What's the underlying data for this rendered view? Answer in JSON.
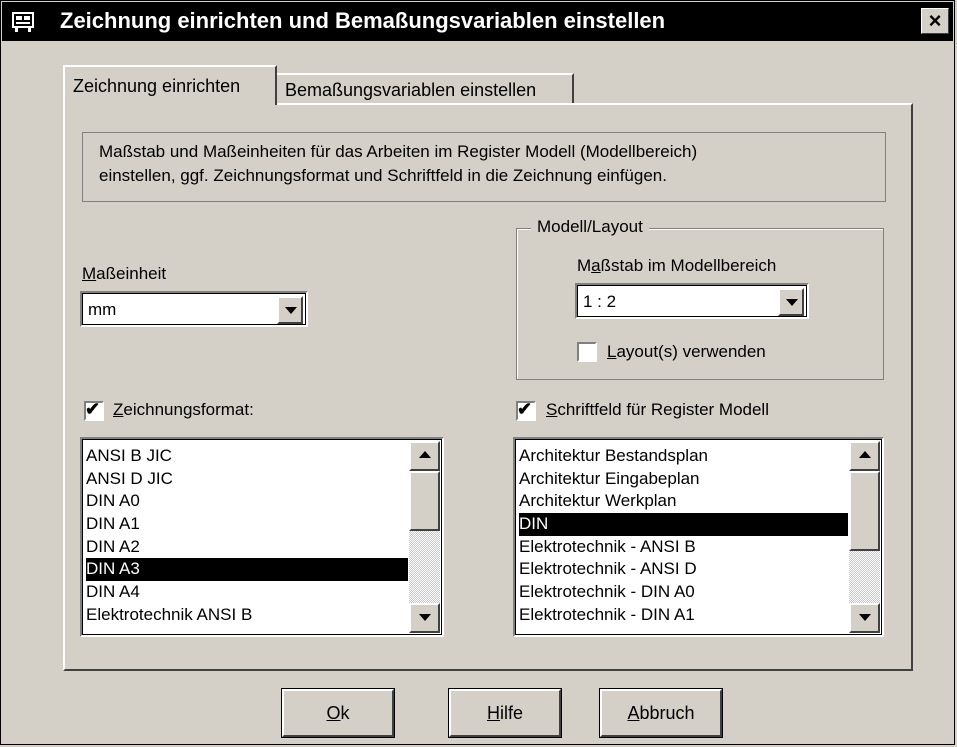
{
  "window": {
    "title": "Zeichnung einrichten und Bemaßungsvariablen einstellen",
    "close_label": "×"
  },
  "tabs": [
    {
      "label": "Zeichnung einrichten",
      "active": true
    },
    {
      "label": "Bemaßungsvariablen einstellen",
      "active": false
    }
  ],
  "description": {
    "line1": "Maßstab und Maßeinheiten für das Arbeiten im Register Modell (Modellbereich)",
    "line2": "einstellen, ggf. Zeichnungsformat und Schriftfeld in die Zeichnung einfügen."
  },
  "unit": {
    "label_accel": "M",
    "label_rest": "aßeinheit",
    "value": "mm"
  },
  "model_layout": {
    "legend": "Modell/Layout",
    "scale_label_pre": "M",
    "scale_label_accel": "a",
    "scale_label_rest": "ßstab im Modellbereich",
    "scale_value": "1 : 2",
    "layout_checkbox_accel": "L",
    "layout_checkbox_rest": "ayout(s) verwenden",
    "layout_checked": false
  },
  "format": {
    "checkbox_accel": "Z",
    "checkbox_rest": "eichnungsformat:",
    "checked": true,
    "check_glyph": "✔",
    "items": [
      "ANSI B JIC",
      "ANSI D JIC",
      "DIN A0",
      "DIN A1",
      "DIN A2",
      "DIN A3",
      "DIN A4",
      "Elektrotechnik ANSI B"
    ],
    "selected": "DIN A3"
  },
  "title_block": {
    "checkbox_accel": "S",
    "checkbox_rest": "chriftfeld für Register Modell",
    "checked": true,
    "check_glyph": "✔",
    "items": [
      "Architektur Bestandsplan",
      "Architektur Eingabeplan",
      "Architektur Werkplan",
      "DIN",
      "Elektrotechnik - ANSI B",
      "Elektrotechnik - ANSI D",
      "Elektrotechnik - DIN A0",
      "Elektrotechnik - DIN A1"
    ],
    "selected": "DIN"
  },
  "buttons": {
    "ok_accel": "O",
    "ok_rest": "k",
    "help_accel": "H",
    "help_rest": "ilfe",
    "cancel_accel": "A",
    "cancel_rest": "bbruch"
  }
}
